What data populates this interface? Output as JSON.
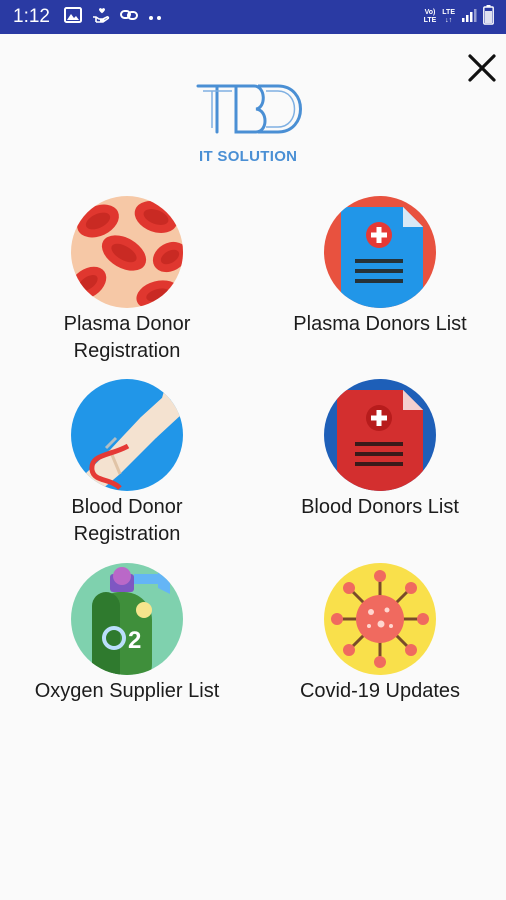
{
  "status_bar": {
    "time": "1:12",
    "volte_top": "Vo)",
    "volte_bottom": "LTE",
    "lte_top": "LTE",
    "lte_bottom": "↓↑"
  },
  "logo": {
    "letters": "TBD",
    "subtitle": "IT SOLUTION",
    "color": "#4a8fd4"
  },
  "menu": [
    {
      "label": "Plasma Donor\nRegistration",
      "icon": "red-blood-cells-icon"
    },
    {
      "label": "Plasma Donors List",
      "icon": "blue-document-icon"
    },
    {
      "label": "Blood  Donor\nRegistration",
      "icon": "arm-blood-donation-icon"
    },
    {
      "label": "Blood Donors List",
      "icon": "red-document-icon"
    },
    {
      "label": "Oxygen Supplier List",
      "icon": "oxygen-cylinder-icon"
    },
    {
      "label": "Covid-19 Updates",
      "icon": "virus-icon"
    }
  ],
  "colors": {
    "status_bar": "#2a3aa3",
    "background": "#fafafa",
    "text": "#1c1c1c"
  }
}
